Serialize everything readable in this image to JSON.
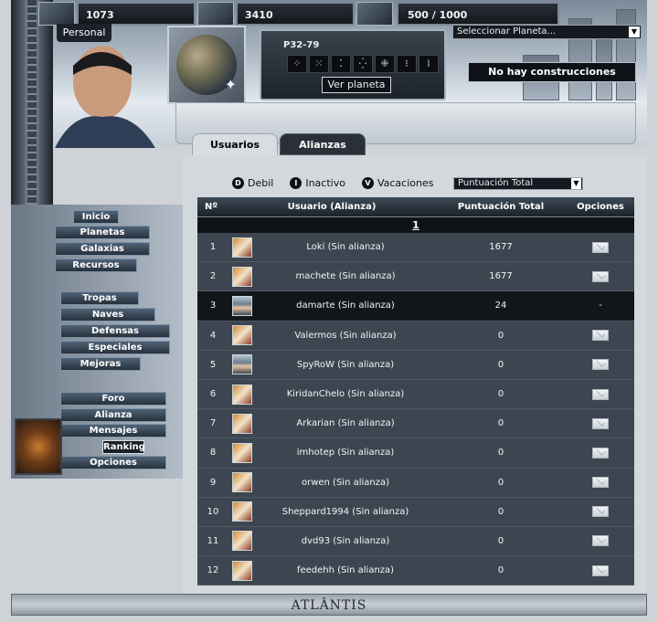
{
  "resources": [
    {
      "icon": "resource-1-icon",
      "value": "1073"
    },
    {
      "icon": "resource-2-icon",
      "value": "3410"
    },
    {
      "icon": "resource-3-icon",
      "value": "500 / 1000"
    }
  ],
  "header": {
    "personal_tab": "Personal",
    "planet_address": "P32-79",
    "glyphs": [
      "⁘",
      "⁙",
      "⁚",
      "⁛",
      "⁜",
      "⁝",
      "⁞"
    ],
    "view_planet_button": "Ver planeta",
    "planet_select": "Seleccionar Planeta...",
    "construction_status": "No hay construcciones"
  },
  "tabs": [
    "Usuarios",
    "Alianzas"
  ],
  "legend": {
    "weak": {
      "letter": "D",
      "label": "Debil"
    },
    "inactive": {
      "letter": "I",
      "label": "Inactivo"
    },
    "vacation": {
      "letter": "V",
      "label": "Vacaciones"
    }
  },
  "sort_select": "Puntuación Total",
  "table": {
    "headers": [
      "Nº",
      "Usuario (Alianza)",
      "Puntuación Total",
      "Opciones"
    ],
    "page": "1",
    "rows": [
      {
        "num": "1",
        "user": "Loki (Sin alianza)",
        "score": "1677",
        "avatar": "logo",
        "option": "mail"
      },
      {
        "num": "2",
        "user": "machete (Sin alianza)",
        "score": "1677",
        "avatar": "logo",
        "option": "mail"
      },
      {
        "num": "3",
        "user": "damarte (Sin alianza)",
        "score": "24",
        "avatar": "human",
        "option": "-"
      },
      {
        "num": "4",
        "user": "Valermos (Sin alianza)",
        "score": "0",
        "avatar": "logo",
        "option": "mail"
      },
      {
        "num": "5",
        "user": "SpyRoW (Sin alianza)",
        "score": "0",
        "avatar": "human",
        "option": "mail"
      },
      {
        "num": "6",
        "user": "KiridanChelo (Sin alianza)",
        "score": "0",
        "avatar": "logo",
        "option": "mail"
      },
      {
        "num": "7",
        "user": "Arkarian (Sin alianza)",
        "score": "0",
        "avatar": "logo",
        "option": "mail"
      },
      {
        "num": "8",
        "user": "imhotep (Sin alianza)",
        "score": "0",
        "avatar": "logo",
        "option": "mail"
      },
      {
        "num": "9",
        "user": "orwen (Sin alianza)",
        "score": "0",
        "avatar": "logo",
        "option": "mail"
      },
      {
        "num": "10",
        "user": "Sheppard1994 (Sin alianza)",
        "score": "0",
        "avatar": "logo",
        "option": "mail"
      },
      {
        "num": "11",
        "user": "dvd93 (Sin alianza)",
        "score": "0",
        "avatar": "logo",
        "option": "mail"
      },
      {
        "num": "12",
        "user": "feedehh (Sin alianza)",
        "score": "0",
        "avatar": "logo",
        "option": "mail"
      }
    ]
  },
  "nav": {
    "group1": [
      "Inicio",
      "Planetas",
      "Galaxias",
      "Recursos"
    ],
    "group2": [
      "Tropas",
      "Naves",
      "Defensas",
      "Especiales",
      "Mejoras"
    ],
    "group3": [
      "Foro",
      "Alianza",
      "Mensajes",
      "Ranking",
      "Opciones"
    ],
    "active": "Ranking"
  },
  "footer_logo_text": "ATLÂNTIS"
}
